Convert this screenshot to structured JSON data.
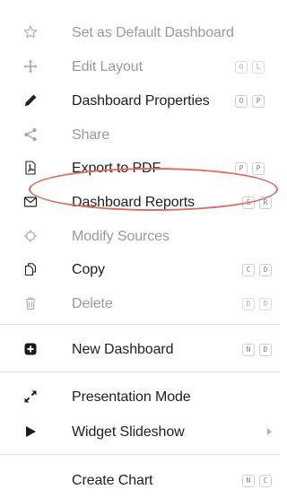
{
  "menu": {
    "items": [
      {
        "label": "Set as Default Dashboard",
        "icon": "star-outline-icon",
        "disabled": true,
        "keys": []
      },
      {
        "label": "Edit Layout",
        "icon": "move-arrows-icon",
        "disabled": true,
        "keys": [
          "O",
          "L"
        ]
      },
      {
        "label": "Dashboard Properties",
        "icon": "pencil-icon",
        "disabled": false,
        "keys": [
          "O",
          "P"
        ]
      },
      {
        "label": "Share",
        "icon": "share-icon",
        "disabled": true,
        "keys": []
      },
      {
        "label": "Export to PDF",
        "icon": "pdf-file-icon",
        "disabled": false,
        "keys": [
          "P",
          "P"
        ]
      },
      {
        "label": "Dashboard Reports",
        "icon": "envelope-icon",
        "disabled": false,
        "keys": [
          "S",
          "R"
        ]
      },
      {
        "label": "Modify Sources",
        "icon": "crosshair-icon",
        "disabled": true,
        "keys": []
      },
      {
        "label": "Copy",
        "icon": "copy-icon",
        "disabled": false,
        "keys": [
          "C",
          "D"
        ]
      },
      {
        "label": "Delete",
        "icon": "trash-icon",
        "disabled": true,
        "keys": [
          "D",
          "D"
        ]
      },
      {
        "label": "New Dashboard",
        "icon": "plus-square-icon",
        "disabled": false,
        "keys": [
          "N",
          "D"
        ]
      },
      {
        "label": "Presentation Mode",
        "icon": "expand-icon",
        "disabled": false,
        "keys": []
      },
      {
        "label": "Widget Slideshow",
        "icon": "play-icon",
        "disabled": false,
        "keys": [],
        "submenu": true
      },
      {
        "label": "Create Chart",
        "icon": "",
        "disabled": false,
        "keys": [
          "N",
          "C"
        ]
      }
    ]
  },
  "highlight": {
    "item": "Dashboard Reports",
    "color": "#e06a5e"
  }
}
